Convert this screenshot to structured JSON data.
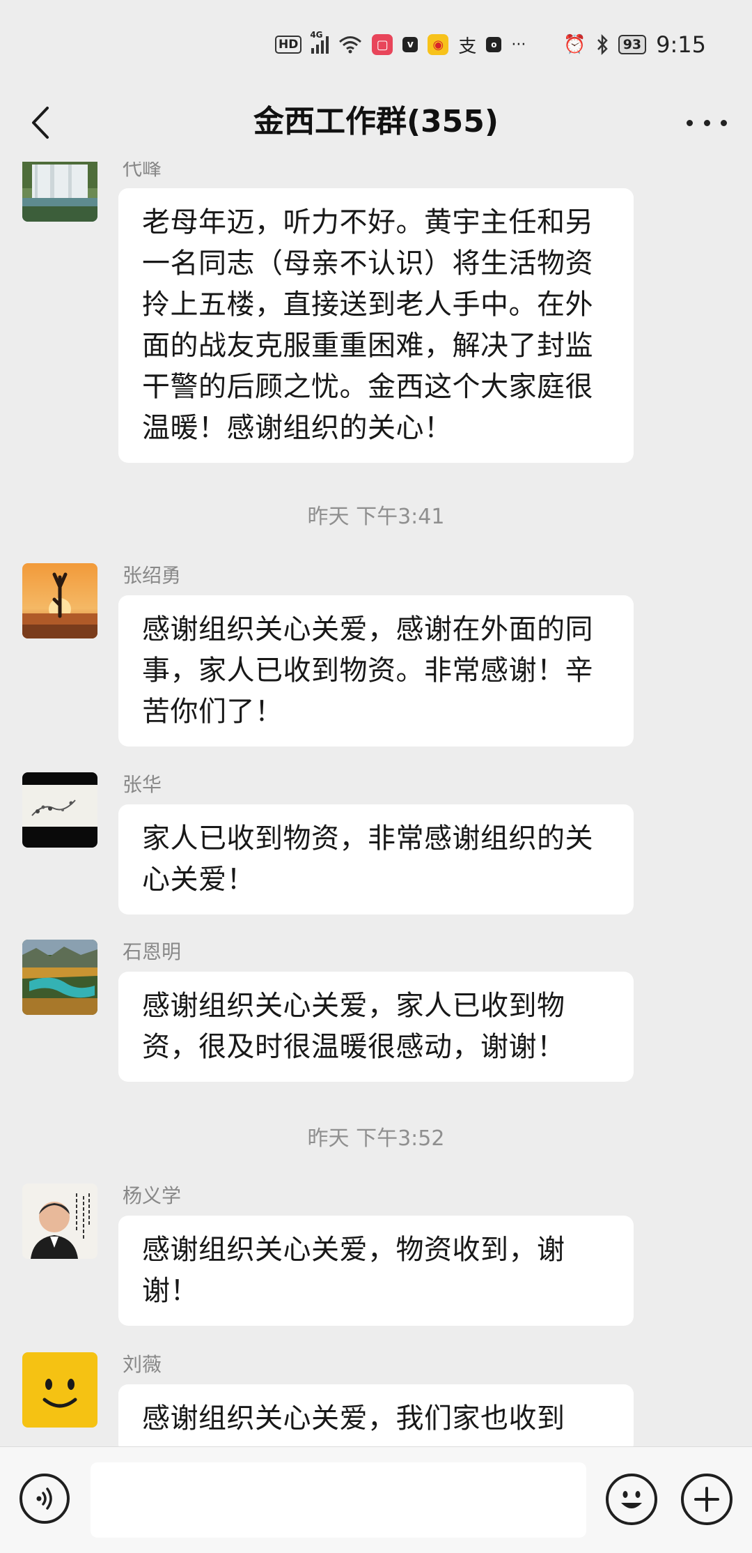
{
  "status_bar": {
    "hd": "HD",
    "network": "4G",
    "battery": "93",
    "time": "9:15",
    "ellipsis": "···",
    "icons": [
      "hd-icon",
      "signal-icon",
      "wifi-icon",
      "app-notification-icon",
      "vpn-icon",
      "weibo-icon",
      "alipay-icon",
      "app-icon",
      "alarm-icon",
      "bluetooth-icon",
      "battery-icon"
    ]
  },
  "header": {
    "title": "金西工作群(355)"
  },
  "messages": [
    {
      "sender": "代峰",
      "text": "老母年迈，听力不好。黄宇主任和另一名同志（母亲不认识）将生活物资拎上五楼，直接送到老人手中。在外面的战友克服重重困难，解决了封监干警的后顾之忧。金西这个大家庭很温暖！感谢组织的关心！",
      "avatar": "waterfall-avatar"
    },
    {
      "time": "昨天 下午3:41"
    },
    {
      "sender": "张绍勇",
      "text": "感谢组织关心关爱，感谢在外面的同事，家人已收到物资。非常感谢！辛苦你们了！",
      "avatar": "yoga-sunset-avatar"
    },
    {
      "sender": "张华",
      "text": "家人已收到物资，非常感谢组织的关心关爱！",
      "avatar": "ink-painting-avatar"
    },
    {
      "sender": "石恩明",
      "text": "感谢组织关心关爱，家人已收到物资，很及时很温暖很感动，谢谢！",
      "avatar": "lake-forest-avatar"
    },
    {
      "time": "昨天 下午3:52"
    },
    {
      "sender": "杨义学",
      "text": "感谢组织关心关爱，物资收到，谢谢！",
      "avatar": "portrait-calligraphy-avatar"
    },
    {
      "sender": "刘薇",
      "text": "感谢组织关心关爱，我们家也收到",
      "avatar": "smiley-avatar"
    }
  ],
  "input_bar": {
    "placeholder": "",
    "icons": [
      "voice-icon",
      "emoji-icon",
      "plus-icon"
    ]
  },
  "colors": {
    "background": "#ededed",
    "bubble": "#ffffff",
    "time_text": "#8f8f8f",
    "sender_text": "#888888",
    "smiley_yellow": "#f5c213"
  }
}
